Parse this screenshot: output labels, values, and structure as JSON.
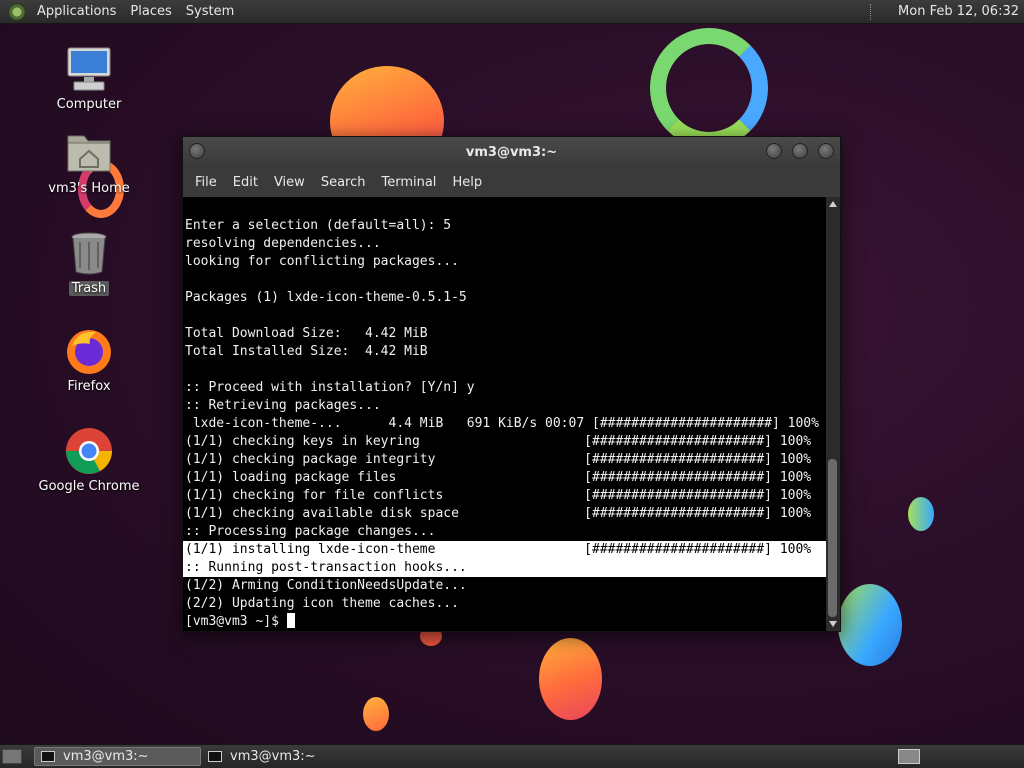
{
  "top_panel": {
    "menus": [
      "Applications",
      "Places",
      "System"
    ],
    "clock": "Mon Feb 12, 06:32"
  },
  "desktop_icons": [
    {
      "label": "Computer",
      "icon": "computer-icon"
    },
    {
      "label": "vm3's Home",
      "icon": "home-folder-icon"
    },
    {
      "label": "Trash",
      "icon": "trash-icon"
    },
    {
      "label": "Firefox",
      "icon": "firefox-icon"
    },
    {
      "label": "Google Chrome",
      "icon": "chrome-icon"
    }
  ],
  "window": {
    "title": "vm3@vm3:~",
    "menubar": [
      "File",
      "Edit",
      "View",
      "Search",
      "Terminal",
      "Help"
    ]
  },
  "terminal": {
    "lines": [
      "Enter a selection (default=all): 5",
      "resolving dependencies...",
      "looking for conflicting packages...",
      "",
      "Packages (1) lxde-icon-theme-0.5.1-5",
      "",
      "Total Download Size:   4.42 MiB",
      "Total Installed Size:  4.42 MiB",
      "",
      ":: Proceed with installation? [Y/n] y",
      ":: Retrieving packages...",
      " lxde-icon-theme-...      4.4 MiB   691 KiB/s 00:07 [######################] 100%",
      "(1/1) checking keys in keyring                     [######################] 100%",
      "(1/1) checking package integrity                   [######################] 100%",
      "(1/1) loading package files                        [######################] 100%",
      "(1/1) checking for file conflicts                  [######################] 100%",
      "(1/1) checking available disk space                [######################] 100%",
      ":: Processing package changes...",
      "(1/1) installing lxde-icon-theme                   [######################] 100%",
      ":: Running post-transaction hooks...",
      "(1/2) Arming ConditionNeedsUpdate...",
      "(2/2) Updating icon theme caches..."
    ],
    "prompt": "[vm3@vm3 ~]$ "
  },
  "taskbar": {
    "tasks": [
      {
        "label": "vm3@vm3:~",
        "active": true
      },
      {
        "label": "vm3@vm3:~",
        "active": false
      }
    ]
  }
}
